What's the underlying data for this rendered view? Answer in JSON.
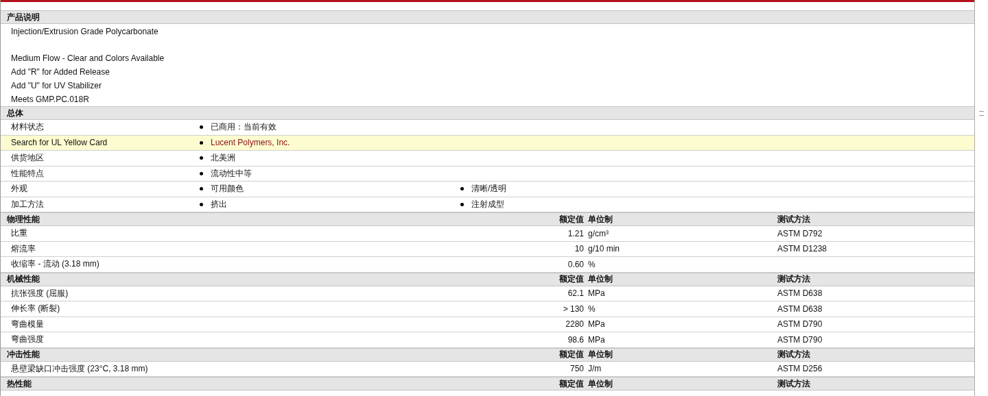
{
  "sections": [
    {
      "kind": "description",
      "title": "产品说明",
      "paragraphs": [
        [
          "Injection/Extrusion Grade Polycarbonate"
        ],
        [
          "Medium Flow - Clear and Colors Available",
          "Add \"R\" for Added Release",
          "Add \"U\" for UV Stabilizer",
          "Meets GMP.PC.018R"
        ]
      ]
    },
    {
      "kind": "general",
      "title": "总体",
      "rows": [
        {
          "label": "材料状态",
          "highlighted": false,
          "values": [
            "已商用：当前有效"
          ]
        },
        {
          "label": "Search for UL Yellow Card",
          "highlighted": true,
          "values": [
            "Lucent Polymers, Inc."
          ]
        },
        {
          "label": "供货地区",
          "highlighted": false,
          "values": [
            "北美洲"
          ]
        },
        {
          "label": "性能特点",
          "highlighted": false,
          "values": [
            "流动性中等"
          ]
        },
        {
          "label": "外观",
          "highlighted": false,
          "values": [
            "可用颜色",
            "清晰/透明"
          ]
        },
        {
          "label": "加工方法",
          "highlighted": false,
          "values": [
            "挤出",
            "注射成型"
          ]
        }
      ]
    },
    {
      "kind": "properties",
      "title": "物理性能",
      "value_heading": "额定值",
      "unit_heading": "单位制",
      "method_heading": "测试方法",
      "rows": [
        {
          "label": "比重",
          "value": "1.21",
          "unit": "g/cm³",
          "method": "ASTM D792"
        },
        {
          "label": "熔流率",
          "value": "10",
          "unit": "g/10 min",
          "method": "ASTM D1238"
        },
        {
          "label": "收缩率  - 流动  (3.18 mm)",
          "value": "0.60",
          "unit": "%"
        }
      ]
    },
    {
      "kind": "properties",
      "title": "机械性能",
      "value_heading": "额定值",
      "unit_heading": "单位制",
      "method_heading": "测试方法",
      "rows": [
        {
          "label": "抗张强度  (屈服)",
          "value": "62.1",
          "unit": "MPa",
          "method": "ASTM D638"
        },
        {
          "label": "伸长率  (断裂)",
          "value": "> 130",
          "unit": "%",
          "method": "ASTM D638"
        },
        {
          "label": "弯曲模量",
          "value": "2280",
          "unit": "MPa",
          "method": "ASTM D790"
        },
        {
          "label": "弯曲强度",
          "value": "98.6",
          "unit": "MPa",
          "method": "ASTM D790"
        }
      ]
    },
    {
      "kind": "properties",
      "title": "冲击性能",
      "value_heading": "额定值",
      "unit_heading": "单位制",
      "method_heading": "测试方法",
      "rows": [
        {
          "label": "悬壁梁缺口冲击强度  (23°C, 3.18 mm)",
          "value": "750",
          "unit": "J/m",
          "method": "ASTM D256"
        }
      ]
    },
    {
      "kind": "properties",
      "title": "热性能",
      "value_heading": "额定值",
      "unit_heading": "单位制",
      "method_heading": "测试方法"
    }
  ]
}
